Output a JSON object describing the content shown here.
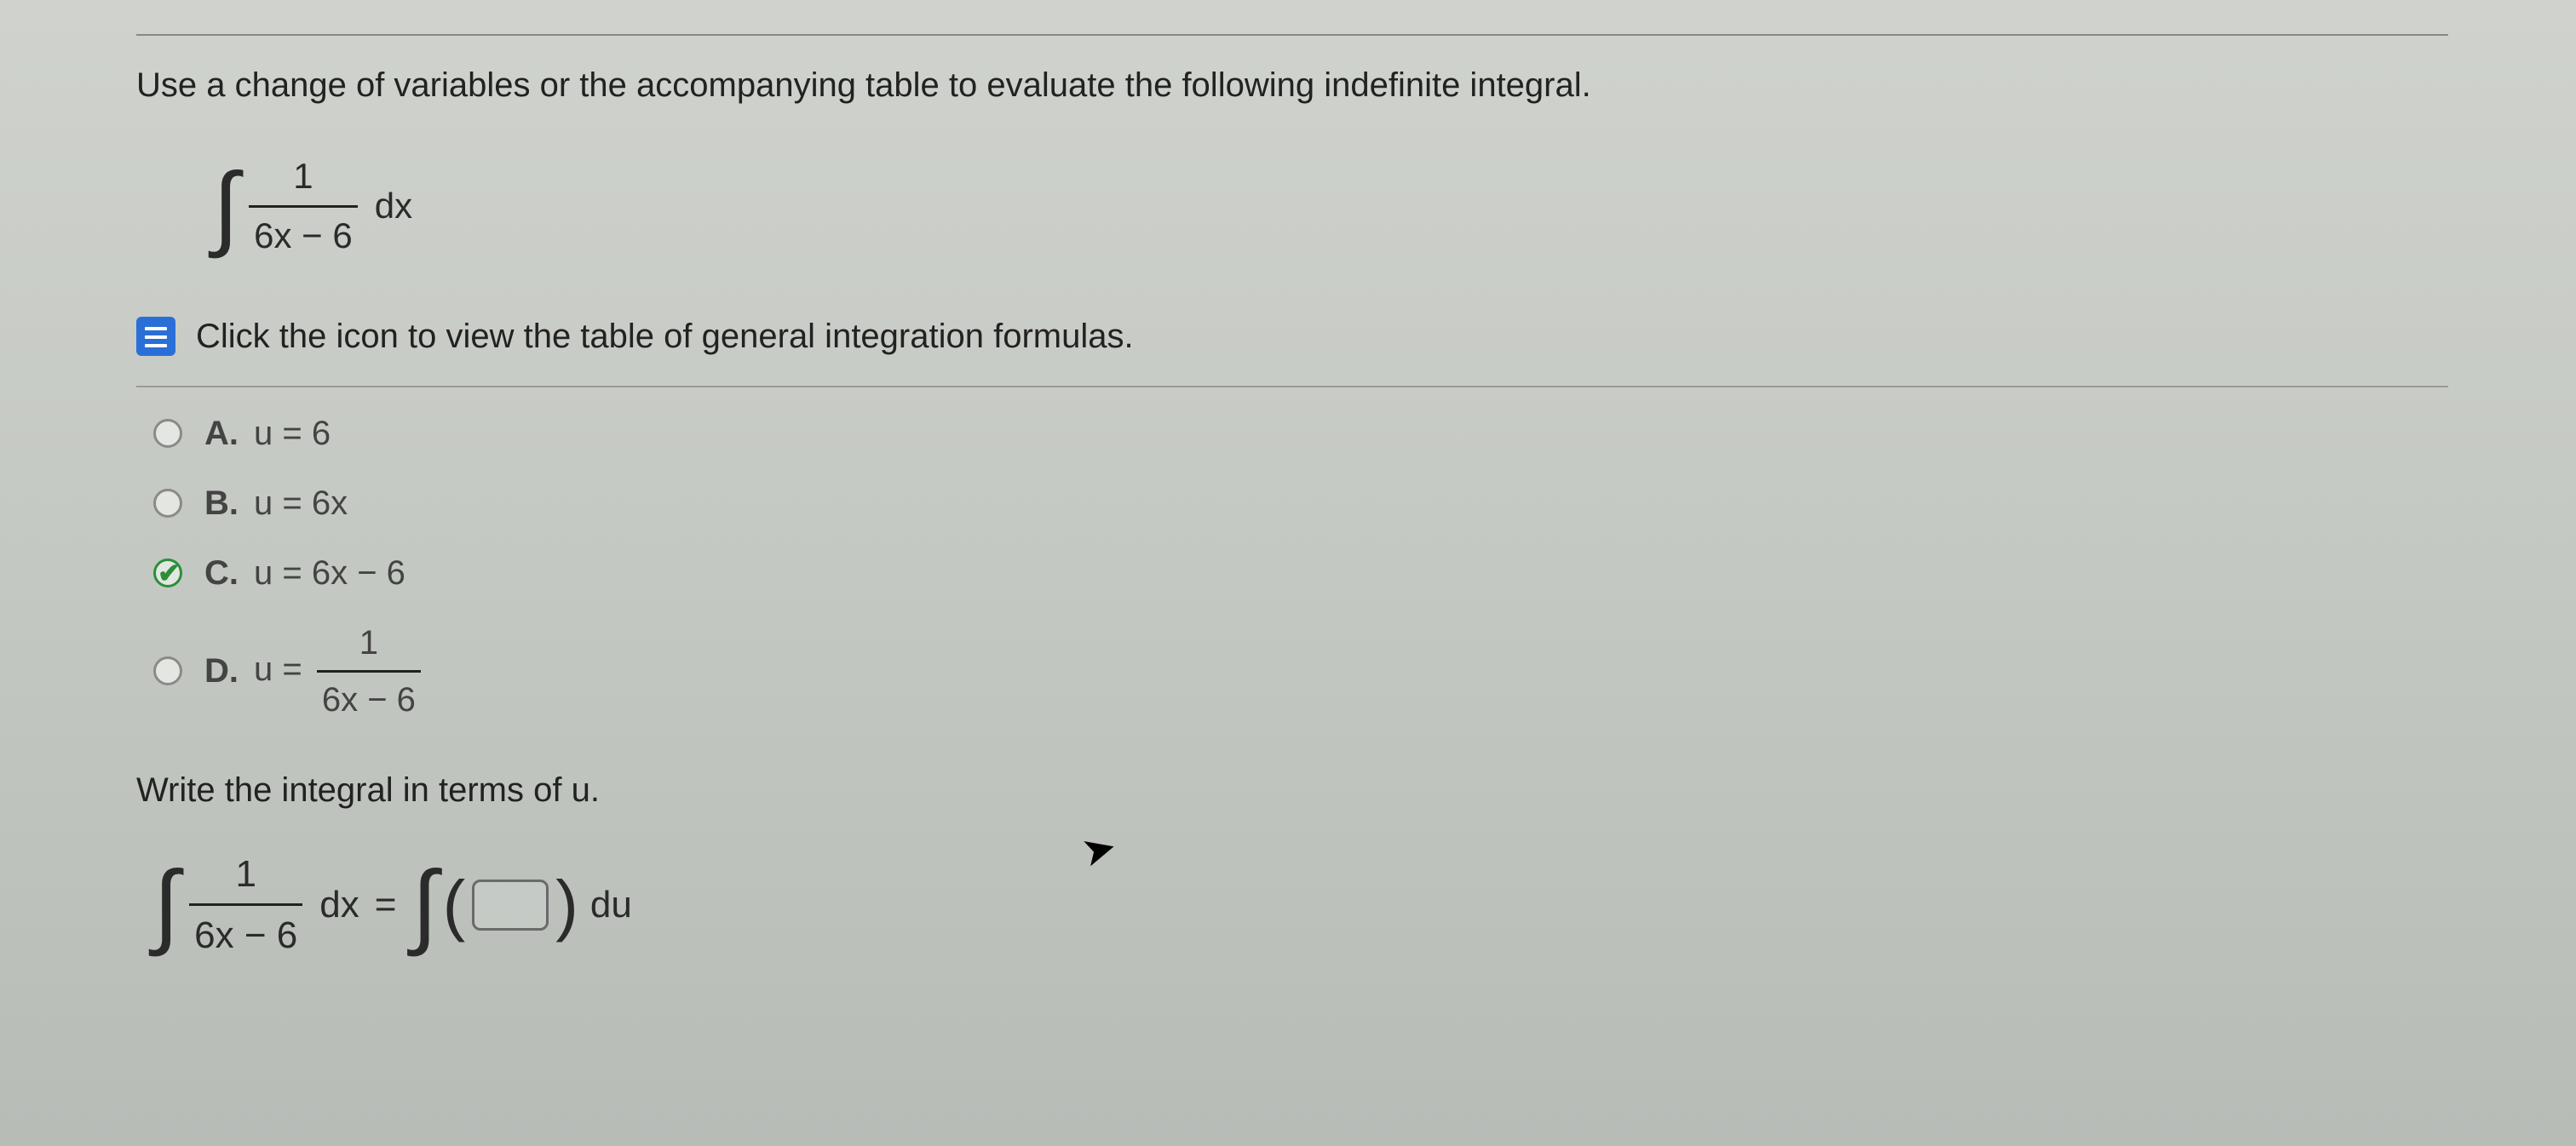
{
  "prompt": "Use a change of variables or the accompanying table to evaluate the following indefinite integral.",
  "integral": {
    "numerator": "1",
    "denominator": "6x − 6",
    "differential": "dx"
  },
  "table_link_text": "Click the icon to view the table of general integration formulas.",
  "choices": [
    {
      "letter": "A.",
      "text": "u = 6",
      "selected": false
    },
    {
      "letter": "B.",
      "text": "u = 6x",
      "selected": false
    },
    {
      "letter": "C.",
      "text": "u = 6x − 6",
      "selected": true
    },
    {
      "letter": "D.",
      "text_prefix": "u =",
      "frac_num": "1",
      "frac_den": "6x − 6",
      "selected": false
    }
  ],
  "sub_prompt": "Write the integral in terms of u.",
  "equation": {
    "lhs_num": "1",
    "lhs_den": "6x − 6",
    "lhs_diff": "dx",
    "equals": "=",
    "rhs_diff": "du"
  }
}
